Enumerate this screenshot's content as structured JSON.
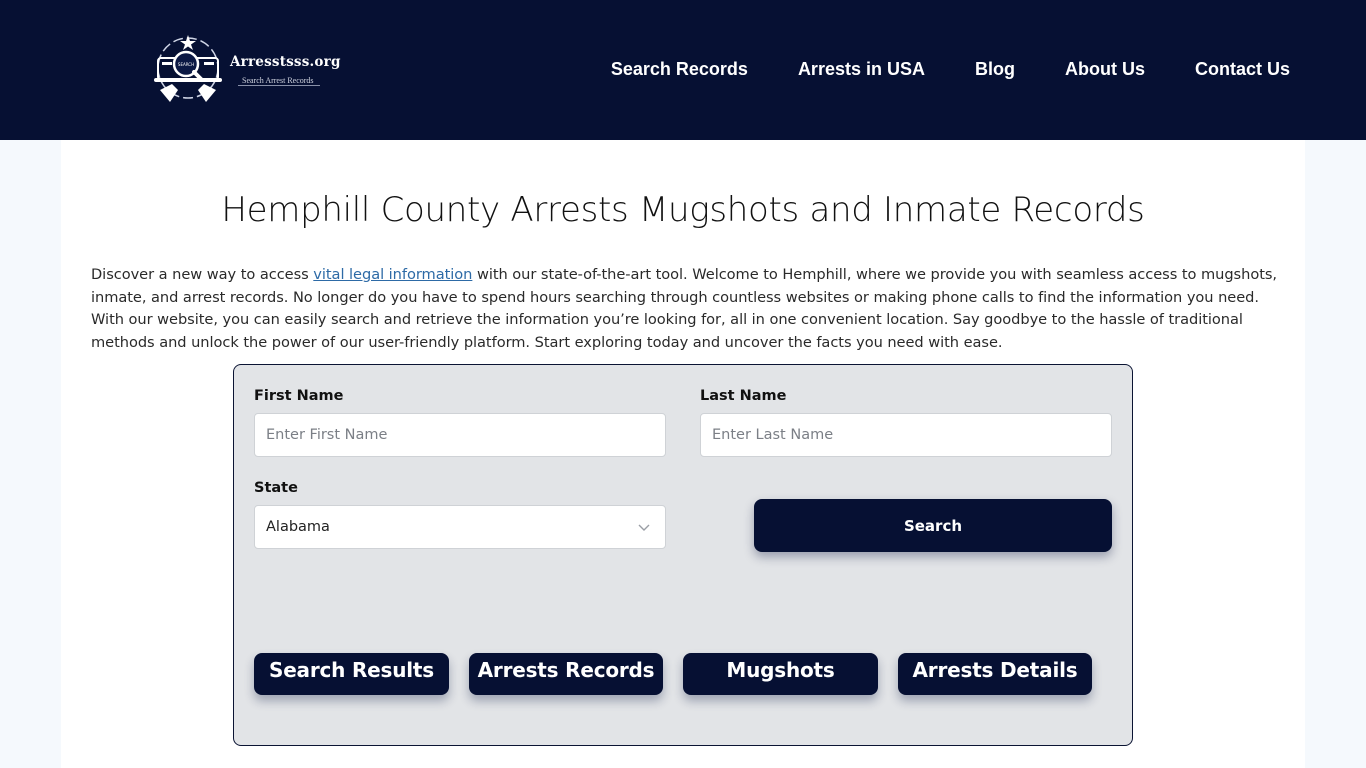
{
  "site": {
    "logo_title": "Arresstsss.org",
    "logo_subtitle": "Search Arrest Records",
    "logo_emblem_text": "SEARCH"
  },
  "nav": {
    "items": [
      {
        "label": "Search Records"
      },
      {
        "label": "Arrests in USA"
      },
      {
        "label": "Blog"
      },
      {
        "label": "About Us"
      },
      {
        "label": "Contact Us"
      }
    ]
  },
  "page": {
    "title": "Hemphill County Arrests Mugshots and Inmate Records",
    "intro_before_link": "Discover a new way to access ",
    "intro_link": "vital legal information",
    "intro_after_link": " with our state-of-the-art tool. Welcome to Hemphill, where we provide you with seamless access to mugshots, inmate, and arrest records. No longer do you have to spend hours searching through countless websites or making phone calls to find the information you need. With our website, you can easily search and retrieve the information you’re looking for, all in one convenient location. Say goodbye to the hassle of traditional methods and unlock the power of our user-friendly platform. Start exploring today and uncover the facts you need with ease."
  },
  "search_form": {
    "first_name_label": "First Name",
    "first_name_placeholder": "Enter First Name",
    "first_name_value": "",
    "last_name_label": "Last Name",
    "last_name_placeholder": "Enter Last Name",
    "last_name_value": "",
    "state_label": "State",
    "state_selected": "Alabama",
    "search_button": "Search"
  },
  "quick_links": [
    {
      "label": "Search Results"
    },
    {
      "label": "Arrests Records"
    },
    {
      "label": "Mugshots"
    },
    {
      "label": "Arrests Details"
    }
  ],
  "colors": {
    "header_bg": "#061033",
    "button_bg": "#061033",
    "card_bg": "#e2e4e7",
    "page_bg": "#f5f9fd",
    "link": "#2d6aa6"
  }
}
